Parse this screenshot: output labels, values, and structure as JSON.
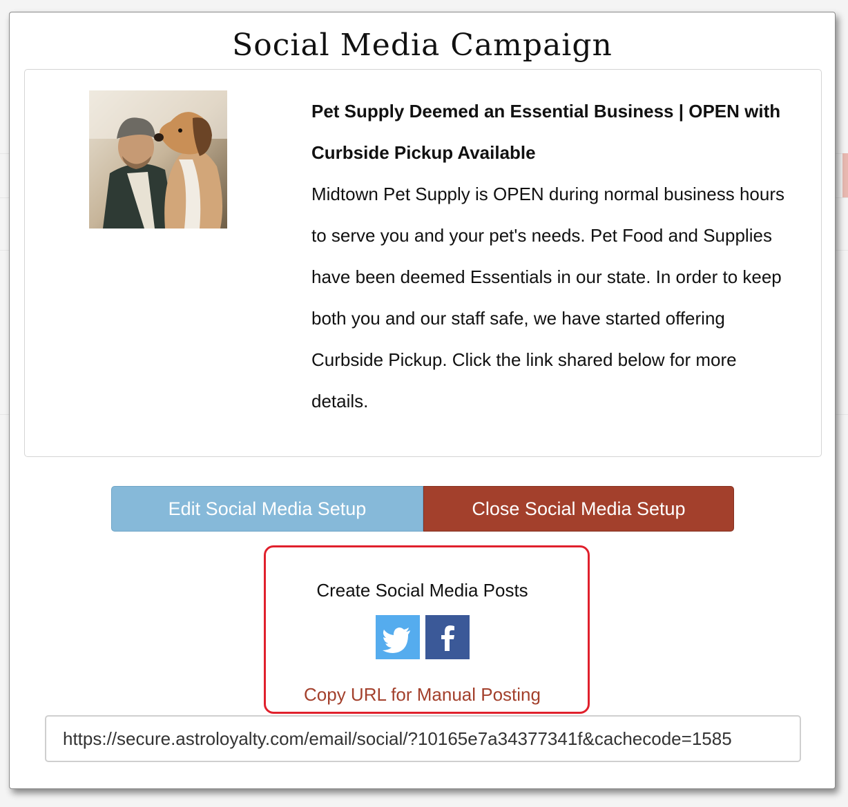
{
  "modal": {
    "title": "Social Media Campaign"
  },
  "post": {
    "image_icon": "man-with-beagle-photo",
    "headline": "Pet Supply Deemed an Essential Business | OPEN with Curbside Pickup Available",
    "body": "Midtown Pet Supply is OPEN during normal business hours to serve you and your pet's needs. Pet Food and Supplies have been deemed Essentials in our state. In order to keep both you and our staff safe, we have started offering Curbside Pickup. Click the link shared below for more details."
  },
  "buttons": {
    "edit_label": "Edit Social Media Setup",
    "close_label": "Close Social Media Setup"
  },
  "social": {
    "heading": "Create Social Media Posts",
    "twitter_icon": "twitter-bird-icon",
    "facebook_icon": "facebook-f-icon",
    "copy_link_label": "Copy URL for Manual Posting"
  },
  "url_field": {
    "value": "https://secure.astroloyalty.com/email/social/?10165e7a34377341f&cachecode=1585"
  },
  "colors": {
    "edit_button": "#86b9d9",
    "close_button": "#a3402c",
    "twitter": "#55acee",
    "facebook": "#3b5998",
    "highlight_border": "#e0202c",
    "link": "#a3402c"
  }
}
